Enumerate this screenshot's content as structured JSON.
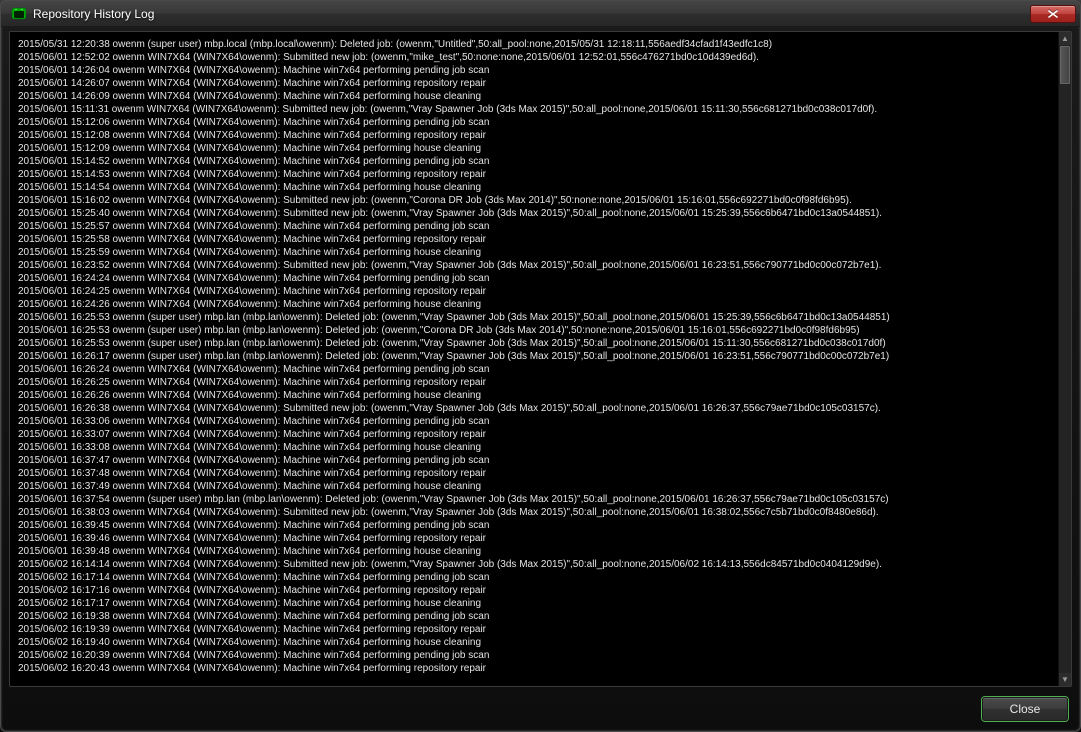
{
  "window": {
    "title": "Repository History Log",
    "icon_name": "app-icon"
  },
  "buttons": {
    "close": "Close"
  },
  "log_lines": [
    "2015/05/31 12:20:38 owenm  (super user) mbp.local (mbp.local\\owenm): Deleted job: (owenm,\"Untitled\",50:all_pool:none,2015/05/31 12:18:11,556aedf34cfad1f43edfc1c8)",
    "2015/06/01 12:52:02 owenm WIN7X64 (WIN7X64\\owenm): Submitted new job: (owenm,\"mike_test\",50:none:none,2015/06/01 12:52:01,556c476271bd0c10d439ed6d).",
    "2015/06/01 14:26:04 owenm WIN7X64 (WIN7X64\\owenm): Machine win7x64 performing pending job scan",
    "2015/06/01 14:26:07 owenm WIN7X64 (WIN7X64\\owenm): Machine win7x64 performing repository repair",
    "2015/06/01 14:26:09 owenm WIN7X64 (WIN7X64\\owenm): Machine win7x64 performing house cleaning",
    "2015/06/01 15:11:31 owenm WIN7X64 (WIN7X64\\owenm): Submitted new job: (owenm,\"Vray Spawner Job (3ds Max 2015)\",50:all_pool:none,2015/06/01 15:11:30,556c681271bd0c038c017d0f).",
    "2015/06/01 15:12:06 owenm WIN7X64 (WIN7X64\\owenm): Machine win7x64 performing pending job scan",
    "2015/06/01 15:12:08 owenm WIN7X64 (WIN7X64\\owenm): Machine win7x64 performing repository repair",
    "2015/06/01 15:12:09 owenm WIN7X64 (WIN7X64\\owenm): Machine win7x64 performing house cleaning",
    "2015/06/01 15:14:52 owenm WIN7X64 (WIN7X64\\owenm): Machine win7x64 performing pending job scan",
    "2015/06/01 15:14:53 owenm WIN7X64 (WIN7X64\\owenm): Machine win7x64 performing repository repair",
    "2015/06/01 15:14:54 owenm WIN7X64 (WIN7X64\\owenm): Machine win7x64 performing house cleaning",
    "2015/06/01 15:16:02 owenm WIN7X64 (WIN7X64\\owenm): Submitted new job: (owenm,\"Corona DR Job (3ds Max 2014)\",50:none:none,2015/06/01 15:16:01,556c692271bd0c0f98fd6b95).",
    "2015/06/01 15:25:40 owenm WIN7X64 (WIN7X64\\owenm): Submitted new job: (owenm,\"Vray Spawner Job (3ds Max 2015)\",50:all_pool:none,2015/06/01 15:25:39,556c6b6471bd0c13a0544851).",
    "2015/06/01 15:25:57 owenm WIN7X64 (WIN7X64\\owenm): Machine win7x64 performing pending job scan",
    "2015/06/01 15:25:58 owenm WIN7X64 (WIN7X64\\owenm): Machine win7x64 performing repository repair",
    "2015/06/01 15:25:59 owenm WIN7X64 (WIN7X64\\owenm): Machine win7x64 performing house cleaning",
    "2015/06/01 16:23:52 owenm WIN7X64 (WIN7X64\\owenm): Submitted new job: (owenm,\"Vray Spawner Job (3ds Max 2015)\",50:all_pool:none,2015/06/01 16:23:51,556c790771bd0c00c072b7e1).",
    "2015/06/01 16:24:24 owenm WIN7X64 (WIN7X64\\owenm): Machine win7x64 performing pending job scan",
    "2015/06/01 16:24:25 owenm WIN7X64 (WIN7X64\\owenm): Machine win7x64 performing repository repair",
    "2015/06/01 16:24:26 owenm WIN7X64 (WIN7X64\\owenm): Machine win7x64 performing house cleaning",
    "2015/06/01 16:25:53 owenm  (super user) mbp.lan (mbp.lan\\owenm): Deleted job: (owenm,\"Vray Spawner Job (3ds Max 2015)\",50:all_pool:none,2015/06/01 15:25:39,556c6b6471bd0c13a0544851)",
    "2015/06/01 16:25:53 owenm  (super user) mbp.lan (mbp.lan\\owenm): Deleted job: (owenm,\"Corona DR Job (3ds Max 2014)\",50:none:none,2015/06/01 15:16:01,556c692271bd0c0f98fd6b95)",
    "2015/06/01 16:25:53 owenm  (super user) mbp.lan (mbp.lan\\owenm): Deleted job: (owenm,\"Vray Spawner Job (3ds Max 2015)\",50:all_pool:none,2015/06/01 15:11:30,556c681271bd0c038c017d0f)",
    "2015/06/01 16:26:17 owenm  (super user) mbp.lan (mbp.lan\\owenm): Deleted job: (owenm,\"Vray Spawner Job (3ds Max 2015)\",50:all_pool:none,2015/06/01 16:23:51,556c790771bd0c00c072b7e1)",
    "2015/06/01 16:26:24 owenm WIN7X64 (WIN7X64\\owenm): Machine win7x64 performing pending job scan",
    "2015/06/01 16:26:25 owenm WIN7X64 (WIN7X64\\owenm): Machine win7x64 performing repository repair",
    "2015/06/01 16:26:26 owenm WIN7X64 (WIN7X64\\owenm): Machine win7x64 performing house cleaning",
    "2015/06/01 16:26:38 owenm WIN7X64 (WIN7X64\\owenm): Submitted new job: (owenm,\"Vray Spawner Job (3ds Max 2015)\",50:all_pool:none,2015/06/01 16:26:37,556c79ae71bd0c105c03157c).",
    "2015/06/01 16:33:06 owenm WIN7X64 (WIN7X64\\owenm): Machine win7x64 performing pending job scan",
    "2015/06/01 16:33:07 owenm WIN7X64 (WIN7X64\\owenm): Machine win7x64 performing repository repair",
    "2015/06/01 16:33:08 owenm WIN7X64 (WIN7X64\\owenm): Machine win7x64 performing house cleaning",
    "2015/06/01 16:37:47 owenm WIN7X64 (WIN7X64\\owenm): Machine win7x64 performing pending job scan",
    "2015/06/01 16:37:48 owenm WIN7X64 (WIN7X64\\owenm): Machine win7x64 performing repository repair",
    "2015/06/01 16:37:49 owenm WIN7X64 (WIN7X64\\owenm): Machine win7x64 performing house cleaning",
    "2015/06/01 16:37:54 owenm  (super user) mbp.lan (mbp.lan\\owenm): Deleted job: (owenm,\"Vray Spawner Job (3ds Max 2015)\",50:all_pool:none,2015/06/01 16:26:37,556c79ae71bd0c105c03157c)",
    "2015/06/01 16:38:03 owenm WIN7X64 (WIN7X64\\owenm): Submitted new job: (owenm,\"Vray Spawner Job (3ds Max 2015)\",50:all_pool:none,2015/06/01 16:38:02,556c7c5b71bd0c0f8480e86d).",
    "2015/06/01 16:39:45 owenm WIN7X64 (WIN7X64\\owenm): Machine win7x64 performing pending job scan",
    "2015/06/01 16:39:46 owenm WIN7X64 (WIN7X64\\owenm): Machine win7x64 performing repository repair",
    "2015/06/01 16:39:48 owenm WIN7X64 (WIN7X64\\owenm): Machine win7x64 performing house cleaning",
    "2015/06/02 16:14:14 owenm WIN7X64 (WIN7X64\\owenm): Submitted new job: (owenm,\"Vray Spawner Job (3ds Max 2015)\",50:all_pool:none,2015/06/02 16:14:13,556dc84571bd0c0404129d9e).",
    "2015/06/02 16:17:14 owenm WIN7X64 (WIN7X64\\owenm): Machine win7x64 performing pending job scan",
    "2015/06/02 16:17:16 owenm WIN7X64 (WIN7X64\\owenm): Machine win7x64 performing repository repair",
    "2015/06/02 16:17:17 owenm WIN7X64 (WIN7X64\\owenm): Machine win7x64 performing house cleaning",
    "2015/06/02 16:19:38 owenm WIN7X64 (WIN7X64\\owenm): Machine win7x64 performing pending job scan",
    "2015/06/02 16:19:39 owenm WIN7X64 (WIN7X64\\owenm): Machine win7x64 performing repository repair",
    "2015/06/02 16:19:40 owenm WIN7X64 (WIN7X64\\owenm): Machine win7x64 performing house cleaning",
    "2015/06/02 16:20:39 owenm WIN7X64 (WIN7X64\\owenm): Machine win7x64 performing pending job scan",
    "2015/06/02 16:20:43 owenm WIN7X64 (WIN7X64\\owenm): Machine win7x64 performing repository repair"
  ]
}
